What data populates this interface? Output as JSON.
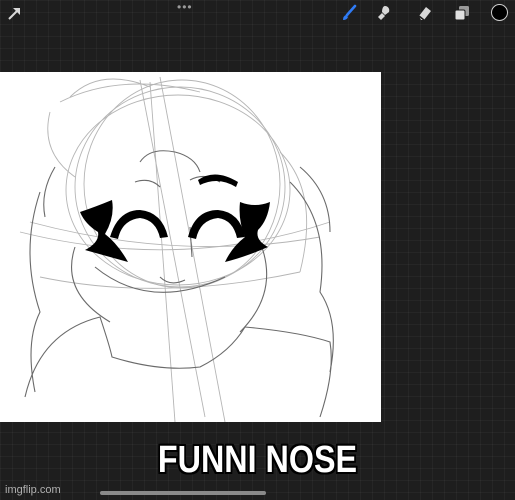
{
  "toolbar": {
    "more_dots": "•••",
    "active_tool": "brush",
    "accent_color": "#2f7bf5",
    "current_color": "#000000"
  },
  "canvas": {
    "background": "#ffffff"
  },
  "caption": "FUNNI NOSE",
  "watermark": "imgflip.com"
}
